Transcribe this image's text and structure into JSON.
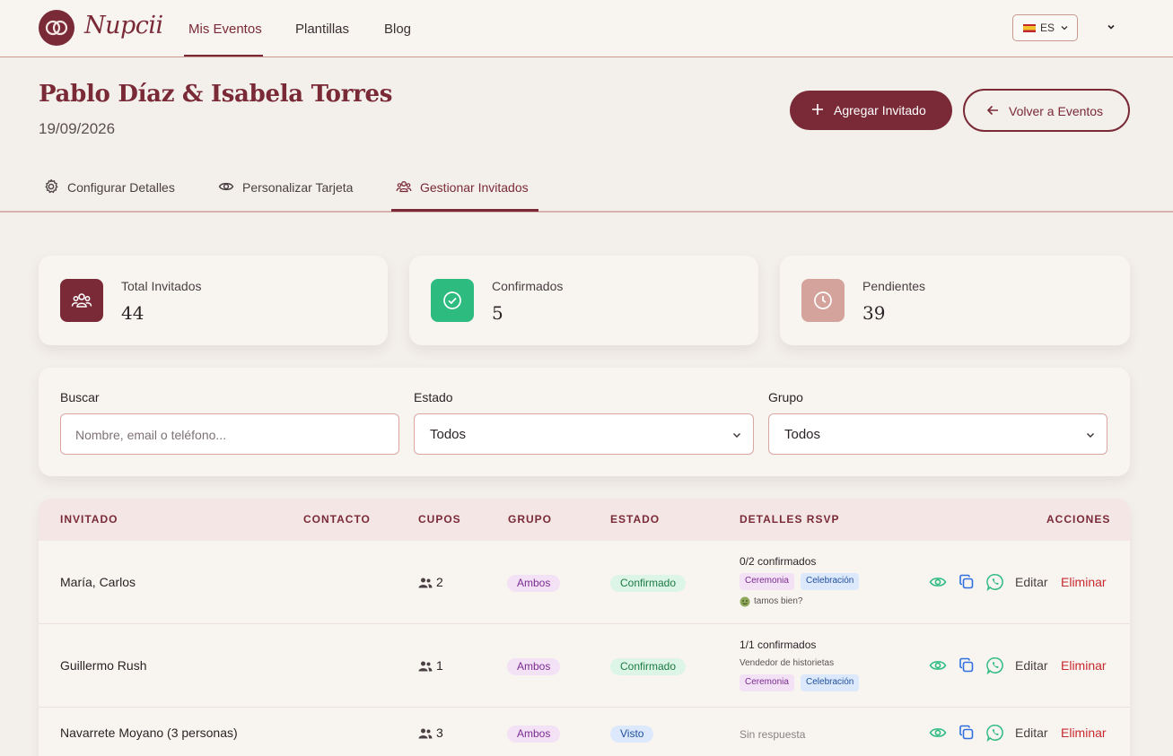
{
  "nav": {
    "brand": "Nupcii",
    "links": [
      "Mis Eventos",
      "Plantillas",
      "Blog"
    ],
    "language": "ES"
  },
  "event": {
    "title": "Pablo Díaz & Isabela Torres",
    "date": "19/09/2026",
    "add_guest": "Agregar Invitado",
    "back": "Volver a Eventos"
  },
  "tabs": [
    "Configurar Detalles",
    "Personalizar Tarjeta",
    "Gestionar Invitados"
  ],
  "stats": [
    {
      "label": "Total Invitados",
      "value": "44",
      "color": "#7a2a37"
    },
    {
      "label": "Confirmados",
      "value": "5",
      "color": "#2dbb7f"
    },
    {
      "label": "Pendientes",
      "value": "39",
      "color": "#d4a39c"
    }
  ],
  "filters": {
    "search_label": "Buscar",
    "search_placeholder": "Nombre, email o teléfono...",
    "state_label": "Estado",
    "state_value": "Todos",
    "group_label": "Grupo",
    "group_value": "Todos"
  },
  "table": {
    "headers": [
      "INVITADO",
      "CONTACTO",
      "CUPOS",
      "GRUPO",
      "ESTADO",
      "DETALLES RSVP",
      "ACCIONES"
    ],
    "edit_label": "Editar",
    "delete_label": "Eliminar",
    "rows": [
      {
        "name": "María, Carlos",
        "cupos": "2",
        "grupo": "Ambos",
        "estado": "Confirmado",
        "rsvp": "0/2 confirmados",
        "tag1": "Ceremonia",
        "tag2": "Celebración",
        "note": "tamos bien?"
      },
      {
        "name": "Guillermo Rush",
        "cupos": "1",
        "grupo": "Ambos",
        "estado": "Confirmado",
        "rsvp": "1/1 confirmados",
        "note": "Vendedor de historietas",
        "tag1": "Ceremonia",
        "tag2": "Celebración"
      },
      {
        "name": "Navarrete Moyano (3 personas)",
        "cupos": "3",
        "grupo": "Ambos",
        "estado": "Visto",
        "rsvp": "Sin respuesta"
      }
    ]
  }
}
